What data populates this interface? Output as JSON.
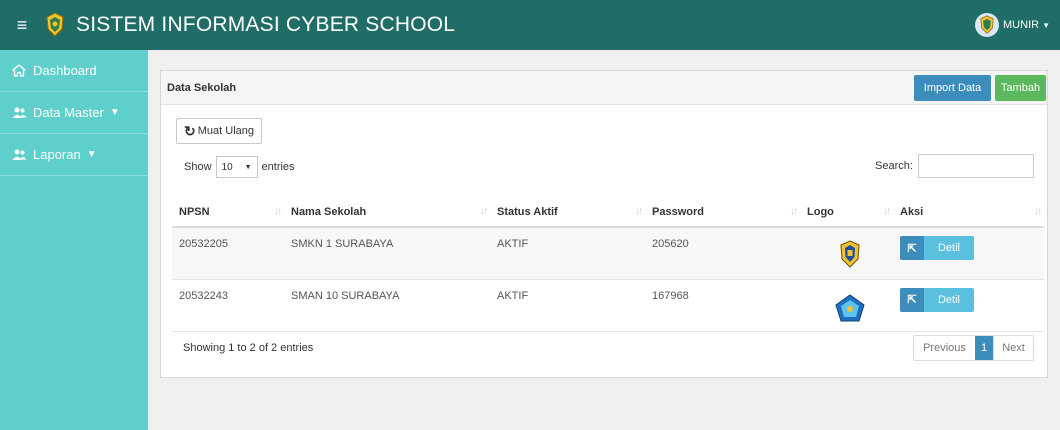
{
  "app": {
    "title": "SISTEM INFORMASI CYBER SCHOOL",
    "user": "MUNIR"
  },
  "sidebar": {
    "items": [
      {
        "label": "Dashboard",
        "icon": "home-icon"
      },
      {
        "label": "Data Master",
        "icon": "users-icon",
        "dropdown": true
      },
      {
        "label": "Laporan",
        "icon": "users-icon",
        "dropdown": true
      }
    ]
  },
  "panel": {
    "title": "Data Sekolah",
    "import_label": "Import Data",
    "add_label": "Tambah",
    "reload_label": "Muat Ulang"
  },
  "table_controls": {
    "show_label": "Show",
    "entries_value": "10",
    "entries_label": "entries",
    "search_label": "Search:",
    "search_value": ""
  },
  "table": {
    "columns": [
      "NPSN",
      "Nama Sekolah",
      "Status Aktif",
      "Password",
      "Logo",
      "Aksi"
    ],
    "rows": [
      {
        "npsn": "20532205",
        "nama": "SMKN 1 SURABAYA",
        "status": "AKTIF",
        "password": "205620",
        "logo": "shield-logo",
        "action": "Detil"
      },
      {
        "npsn": "20532243",
        "nama": "SMAN 10 SURABAYA",
        "status": "AKTIF",
        "password": "167968",
        "logo": "pentagon-logo",
        "action": "Detil"
      }
    ]
  },
  "footer": {
    "info": "Showing 1 to 2 of 2 entries",
    "prev_label": "Previous",
    "page": "1",
    "next_label": "Next"
  },
  "colors": {
    "topbar": "#1f6d66",
    "sidebar": "#5ecfca",
    "primary": "#3c8dbc",
    "success": "#5cb85c",
    "info": "#5bc0de"
  }
}
